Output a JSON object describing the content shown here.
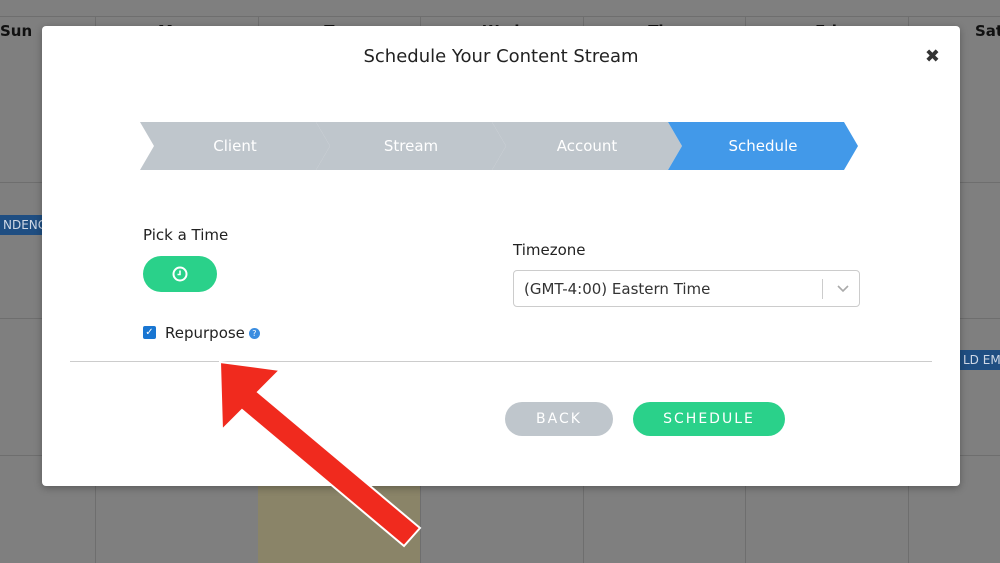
{
  "calendar": {
    "days": [
      "Sun",
      "Mon",
      "Tue",
      "Wed",
      "Thu",
      "Fri",
      "Sat"
    ],
    "chips": [
      "NDENC",
      "LD EM"
    ]
  },
  "modal": {
    "title": "Schedule Your Content Stream",
    "close_icon": "close-x-icon",
    "steps": [
      {
        "label": "Client",
        "active": false
      },
      {
        "label": "Stream",
        "active": false
      },
      {
        "label": "Account",
        "active": false
      },
      {
        "label": "Schedule",
        "active": true
      }
    ],
    "pick_time_label": "Pick a Time",
    "timezone_label": "Timezone",
    "timezone_value": "(GMT-4:00) Eastern Time",
    "repurpose_label": "Repurpose",
    "repurpose_checked": true,
    "help_glyph": "?",
    "back_label": "BACK",
    "schedule_label": "SCHEDULE"
  },
  "colors": {
    "active_step": "#4299e9",
    "inactive_step": "#bfc6cc",
    "green": "#2ad18a",
    "arrow": "#f02a1e"
  }
}
